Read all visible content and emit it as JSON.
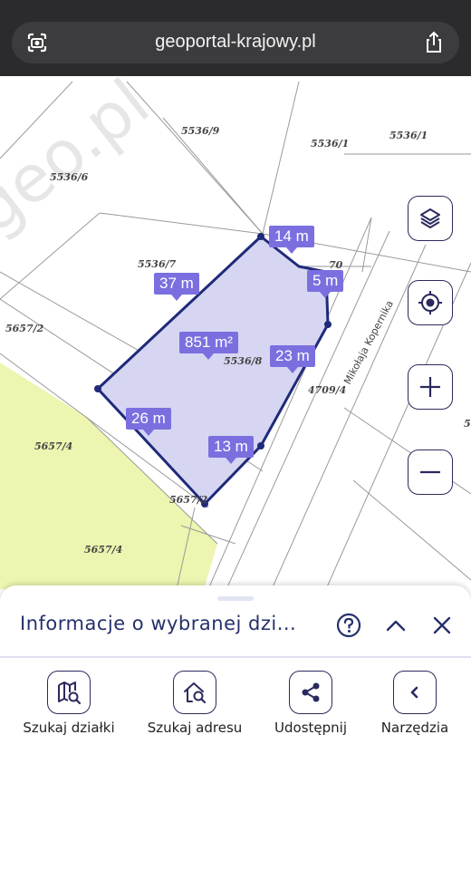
{
  "browser": {
    "url": "geoportal-krajowy.pl"
  },
  "map": {
    "watermark": "geo.pl",
    "street_name": "Mikołaja Kopernika",
    "parcel_labels": [
      "5536/9",
      "5536/1",
      "5536/1",
      "5536/6",
      "5536/7",
      "70",
      "5657/2",
      "5536/8",
      "4709/4",
      "5657/4",
      "5657/2",
      "5657/4",
      "5"
    ],
    "measurements": {
      "area": "851 m²",
      "edge_top": "14 m",
      "edge_right_top": "5 m",
      "edge_left_top": "37 m",
      "edge_right": "23 m",
      "edge_left": "26 m",
      "edge_bottom": "13 m"
    },
    "colors": {
      "parcel_fill": "#d6d6f2",
      "parcel_outline": "#1f2a7a",
      "measure_label_bg": "#7b6fe0",
      "farmland": "#edf5b0"
    }
  },
  "map_controls": [
    "layers-icon",
    "locate-icon",
    "zoom-in-icon",
    "zoom-out-icon"
  ],
  "panel": {
    "title": "Informacje o wybranej dzi...",
    "tools": [
      {
        "label": "Szukaj działki",
        "icon": "map-search-icon"
      },
      {
        "label": "Szukaj adresu",
        "icon": "home-search-icon"
      },
      {
        "label": "Udostępnij",
        "icon": "share-icon"
      },
      {
        "label": "Narzędzia",
        "icon": "tools-arrow-icon"
      }
    ]
  }
}
